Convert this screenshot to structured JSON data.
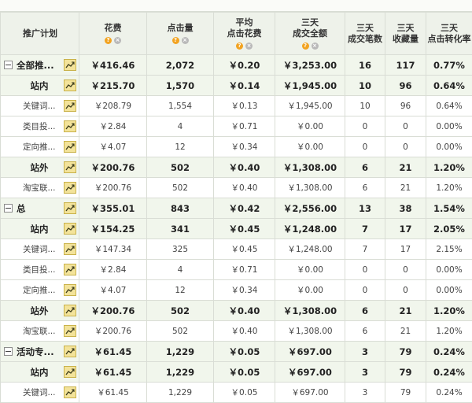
{
  "headers": [
    {
      "id": "name",
      "lines": [
        "推广计划"
      ],
      "icons": false
    },
    {
      "id": "cost",
      "lines": [
        "花费"
      ],
      "icons": true
    },
    {
      "id": "clicks",
      "lines": [
        "点击量"
      ],
      "icons": true
    },
    {
      "id": "avg_cpc",
      "lines": [
        "平均",
        "点击花费"
      ],
      "icons": true
    },
    {
      "id": "gmv3",
      "lines": [
        "三天",
        "成交全额"
      ],
      "icons": true
    },
    {
      "id": "orders3",
      "lines": [
        "三天",
        "成交笔数"
      ],
      "icons": false
    },
    {
      "id": "fav3",
      "lines": [
        "三天",
        "收藏量"
      ],
      "icons": false
    },
    {
      "id": "cvr3",
      "lines": [
        "三天",
        "点击转化率"
      ],
      "icons": false
    }
  ],
  "rows": [
    {
      "level": 0,
      "expander": true,
      "name": "全部推...",
      "cost": "￥416.46",
      "clicks": "2,072",
      "avg_cpc": "￥0.20",
      "gmv3": "￥3,253.00",
      "orders3": "16",
      "fav3": "117",
      "cvr3": "0.77%"
    },
    {
      "level": 1,
      "expander": false,
      "name": "站内",
      "cost": "￥215.70",
      "clicks": "1,570",
      "avg_cpc": "￥0.14",
      "gmv3": "￥1,945.00",
      "orders3": "10",
      "fav3": "96",
      "cvr3": "0.64%"
    },
    {
      "level": 2,
      "expander": false,
      "name": "关键词...",
      "cost": "￥208.79",
      "clicks": "1,554",
      "avg_cpc": "￥0.13",
      "gmv3": "￥1,945.00",
      "orders3": "10",
      "fav3": "96",
      "cvr3": "0.64%"
    },
    {
      "level": 2,
      "expander": false,
      "name": "类目投...",
      "cost": "￥2.84",
      "clicks": "4",
      "avg_cpc": "￥0.71",
      "gmv3": "￥0.00",
      "orders3": "0",
      "fav3": "0",
      "cvr3": "0.00%"
    },
    {
      "level": 2,
      "expander": false,
      "name": "定向推...",
      "cost": "￥4.07",
      "clicks": "12",
      "avg_cpc": "￥0.34",
      "gmv3": "￥0.00",
      "orders3": "0",
      "fav3": "0",
      "cvr3": "0.00%"
    },
    {
      "level": 1,
      "expander": false,
      "name": "站外",
      "cost": "￥200.76",
      "clicks": "502",
      "avg_cpc": "￥0.40",
      "gmv3": "￥1,308.00",
      "orders3": "6",
      "fav3": "21",
      "cvr3": "1.20%"
    },
    {
      "level": 2,
      "expander": false,
      "name": "淘宝联...",
      "cost": "￥200.76",
      "clicks": "502",
      "avg_cpc": "￥0.40",
      "gmv3": "￥1,308.00",
      "orders3": "6",
      "fav3": "21",
      "cvr3": "1.20%"
    },
    {
      "level": 0,
      "expander": true,
      "name": "总",
      "cost": "￥355.01",
      "clicks": "843",
      "avg_cpc": "￥0.42",
      "gmv3": "￥2,556.00",
      "orders3": "13",
      "fav3": "38",
      "cvr3": "1.54%"
    },
    {
      "level": 1,
      "expander": false,
      "name": "站内",
      "cost": "￥154.25",
      "clicks": "341",
      "avg_cpc": "￥0.45",
      "gmv3": "￥1,248.00",
      "orders3": "7",
      "fav3": "17",
      "cvr3": "2.05%"
    },
    {
      "level": 2,
      "expander": false,
      "name": "关键词...",
      "cost": "￥147.34",
      "clicks": "325",
      "avg_cpc": "￥0.45",
      "gmv3": "￥1,248.00",
      "orders3": "7",
      "fav3": "17",
      "cvr3": "2.15%"
    },
    {
      "level": 2,
      "expander": false,
      "name": "类目投...",
      "cost": "￥2.84",
      "clicks": "4",
      "avg_cpc": "￥0.71",
      "gmv3": "￥0.00",
      "orders3": "0",
      "fav3": "0",
      "cvr3": "0.00%"
    },
    {
      "level": 2,
      "expander": false,
      "name": "定向推...",
      "cost": "￥4.07",
      "clicks": "12",
      "avg_cpc": "￥0.34",
      "gmv3": "￥0.00",
      "orders3": "0",
      "fav3": "0",
      "cvr3": "0.00%"
    },
    {
      "level": 1,
      "expander": false,
      "name": "站外",
      "cost": "￥200.76",
      "clicks": "502",
      "avg_cpc": "￥0.40",
      "gmv3": "￥1,308.00",
      "orders3": "6",
      "fav3": "21",
      "cvr3": "1.20%"
    },
    {
      "level": 2,
      "expander": false,
      "name": "淘宝联...",
      "cost": "￥200.76",
      "clicks": "502",
      "avg_cpc": "￥0.40",
      "gmv3": "￥1,308.00",
      "orders3": "6",
      "fav3": "21",
      "cvr3": "1.20%"
    },
    {
      "level": 0,
      "expander": true,
      "name": "活动专...",
      "cost": "￥61.45",
      "clicks": "1,229",
      "avg_cpc": "￥0.05",
      "gmv3": "￥697.00",
      "orders3": "3",
      "fav3": "79",
      "cvr3": "0.24%"
    },
    {
      "level": 1,
      "expander": false,
      "name": "站内",
      "cost": "￥61.45",
      "clicks": "1,229",
      "avg_cpc": "￥0.05",
      "gmv3": "￥697.00",
      "orders3": "3",
      "fav3": "79",
      "cvr3": "0.24%"
    },
    {
      "level": 2,
      "expander": false,
      "name": "关键词...",
      "cost": "￥61.45",
      "clicks": "1,229",
      "avg_cpc": "￥0.05",
      "gmv3": "￥697.00",
      "orders3": "3",
      "fav3": "79",
      "cvr3": "0.24%"
    }
  ],
  "icons": {
    "help": "help-icon",
    "remove": "remove-icon",
    "trend": "trend-chart-icon",
    "expander": "collapse-toggle-icon"
  },
  "colors": {
    "header_bg": "#eef2ea",
    "summary_row_bg": "#f1f6ec",
    "detail_row_bg": "#ffffff",
    "grid": "#d9ddd5",
    "help_icon": "#f2a321",
    "trend_icon_bg": "#f3e39a"
  }
}
